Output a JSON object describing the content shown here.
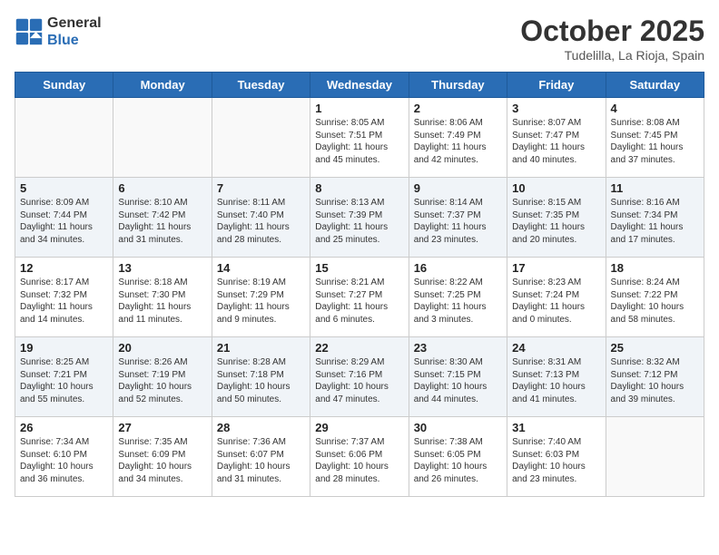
{
  "header": {
    "logo_line1": "General",
    "logo_line2": "Blue",
    "month_year": "October 2025",
    "location": "Tudelilla, La Rioja, Spain"
  },
  "days_of_week": [
    "Sunday",
    "Monday",
    "Tuesday",
    "Wednesday",
    "Thursday",
    "Friday",
    "Saturday"
  ],
  "weeks": [
    [
      {
        "date": "",
        "text": ""
      },
      {
        "date": "",
        "text": ""
      },
      {
        "date": "",
        "text": ""
      },
      {
        "date": "1",
        "text": "Sunrise: 8:05 AM\nSunset: 7:51 PM\nDaylight: 11 hours and 45 minutes."
      },
      {
        "date": "2",
        "text": "Sunrise: 8:06 AM\nSunset: 7:49 PM\nDaylight: 11 hours and 42 minutes."
      },
      {
        "date": "3",
        "text": "Sunrise: 8:07 AM\nSunset: 7:47 PM\nDaylight: 11 hours and 40 minutes."
      },
      {
        "date": "4",
        "text": "Sunrise: 8:08 AM\nSunset: 7:45 PM\nDaylight: 11 hours and 37 minutes."
      }
    ],
    [
      {
        "date": "5",
        "text": "Sunrise: 8:09 AM\nSunset: 7:44 PM\nDaylight: 11 hours and 34 minutes."
      },
      {
        "date": "6",
        "text": "Sunrise: 8:10 AM\nSunset: 7:42 PM\nDaylight: 11 hours and 31 minutes."
      },
      {
        "date": "7",
        "text": "Sunrise: 8:11 AM\nSunset: 7:40 PM\nDaylight: 11 hours and 28 minutes."
      },
      {
        "date": "8",
        "text": "Sunrise: 8:13 AM\nSunset: 7:39 PM\nDaylight: 11 hours and 25 minutes."
      },
      {
        "date": "9",
        "text": "Sunrise: 8:14 AM\nSunset: 7:37 PM\nDaylight: 11 hours and 23 minutes."
      },
      {
        "date": "10",
        "text": "Sunrise: 8:15 AM\nSunset: 7:35 PM\nDaylight: 11 hours and 20 minutes."
      },
      {
        "date": "11",
        "text": "Sunrise: 8:16 AM\nSunset: 7:34 PM\nDaylight: 11 hours and 17 minutes."
      }
    ],
    [
      {
        "date": "12",
        "text": "Sunrise: 8:17 AM\nSunset: 7:32 PM\nDaylight: 11 hours and 14 minutes."
      },
      {
        "date": "13",
        "text": "Sunrise: 8:18 AM\nSunset: 7:30 PM\nDaylight: 11 hours and 11 minutes."
      },
      {
        "date": "14",
        "text": "Sunrise: 8:19 AM\nSunset: 7:29 PM\nDaylight: 11 hours and 9 minutes."
      },
      {
        "date": "15",
        "text": "Sunrise: 8:21 AM\nSunset: 7:27 PM\nDaylight: 11 hours and 6 minutes."
      },
      {
        "date": "16",
        "text": "Sunrise: 8:22 AM\nSunset: 7:25 PM\nDaylight: 11 hours and 3 minutes."
      },
      {
        "date": "17",
        "text": "Sunrise: 8:23 AM\nSunset: 7:24 PM\nDaylight: 11 hours and 0 minutes."
      },
      {
        "date": "18",
        "text": "Sunrise: 8:24 AM\nSunset: 7:22 PM\nDaylight: 10 hours and 58 minutes."
      }
    ],
    [
      {
        "date": "19",
        "text": "Sunrise: 8:25 AM\nSunset: 7:21 PM\nDaylight: 10 hours and 55 minutes."
      },
      {
        "date": "20",
        "text": "Sunrise: 8:26 AM\nSunset: 7:19 PM\nDaylight: 10 hours and 52 minutes."
      },
      {
        "date": "21",
        "text": "Sunrise: 8:28 AM\nSunset: 7:18 PM\nDaylight: 10 hours and 50 minutes."
      },
      {
        "date": "22",
        "text": "Sunrise: 8:29 AM\nSunset: 7:16 PM\nDaylight: 10 hours and 47 minutes."
      },
      {
        "date": "23",
        "text": "Sunrise: 8:30 AM\nSunset: 7:15 PM\nDaylight: 10 hours and 44 minutes."
      },
      {
        "date": "24",
        "text": "Sunrise: 8:31 AM\nSunset: 7:13 PM\nDaylight: 10 hours and 41 minutes."
      },
      {
        "date": "25",
        "text": "Sunrise: 8:32 AM\nSunset: 7:12 PM\nDaylight: 10 hours and 39 minutes."
      }
    ],
    [
      {
        "date": "26",
        "text": "Sunrise: 7:34 AM\nSunset: 6:10 PM\nDaylight: 10 hours and 36 minutes."
      },
      {
        "date": "27",
        "text": "Sunrise: 7:35 AM\nSunset: 6:09 PM\nDaylight: 10 hours and 34 minutes."
      },
      {
        "date": "28",
        "text": "Sunrise: 7:36 AM\nSunset: 6:07 PM\nDaylight: 10 hours and 31 minutes."
      },
      {
        "date": "29",
        "text": "Sunrise: 7:37 AM\nSunset: 6:06 PM\nDaylight: 10 hours and 28 minutes."
      },
      {
        "date": "30",
        "text": "Sunrise: 7:38 AM\nSunset: 6:05 PM\nDaylight: 10 hours and 26 minutes."
      },
      {
        "date": "31",
        "text": "Sunrise: 7:40 AM\nSunset: 6:03 PM\nDaylight: 10 hours and 23 minutes."
      },
      {
        "date": "",
        "text": ""
      }
    ]
  ]
}
